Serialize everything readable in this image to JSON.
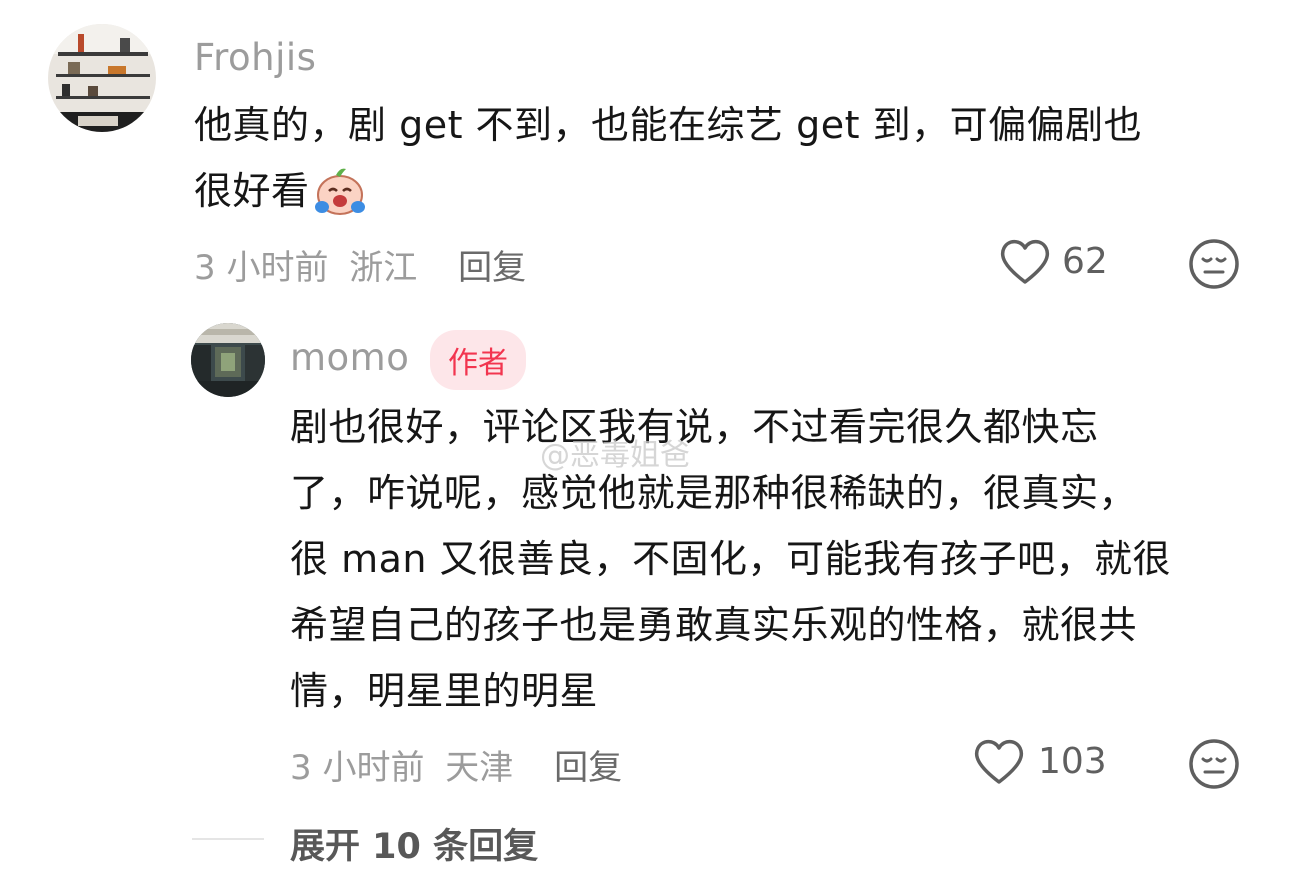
{
  "comments": [
    {
      "username": "Frohjis",
      "line1": "他真的，剧 get 不到，也能在综艺 get 到，可偏偏剧也",
      "line2": "很好看",
      "emoji": "crying-face-emoji",
      "time": "3 小时前",
      "location": "浙江",
      "reply_label": "回复",
      "likes": "62",
      "dislike_icon": "dislike-face-icon",
      "like_icon": "heart-icon"
    }
  ],
  "reply": {
    "username": "momo",
    "badge": "作者",
    "lines": [
      "剧也很好，评论区我有说，不过看完很久都快忘",
      "了，咋说呢，感觉他就是那种很稀缺的，很真实，",
      "很 man 又很善良，不固化，可能我有孩子吧，就很",
      "希望自己的孩子也是勇敢真实乐观的性格，就很共",
      "情，明星里的明星"
    ],
    "time": "3 小时前",
    "location": "天津",
    "reply_label": "回复",
    "likes": "103"
  },
  "expand": {
    "label": "展开 10 条回复"
  },
  "watermark": "@恶毒姐爸",
  "colors": {
    "badge_text": "#f2354f",
    "badge_bg": "#fde6e9",
    "meta_gray": "#9c9c9c"
  }
}
